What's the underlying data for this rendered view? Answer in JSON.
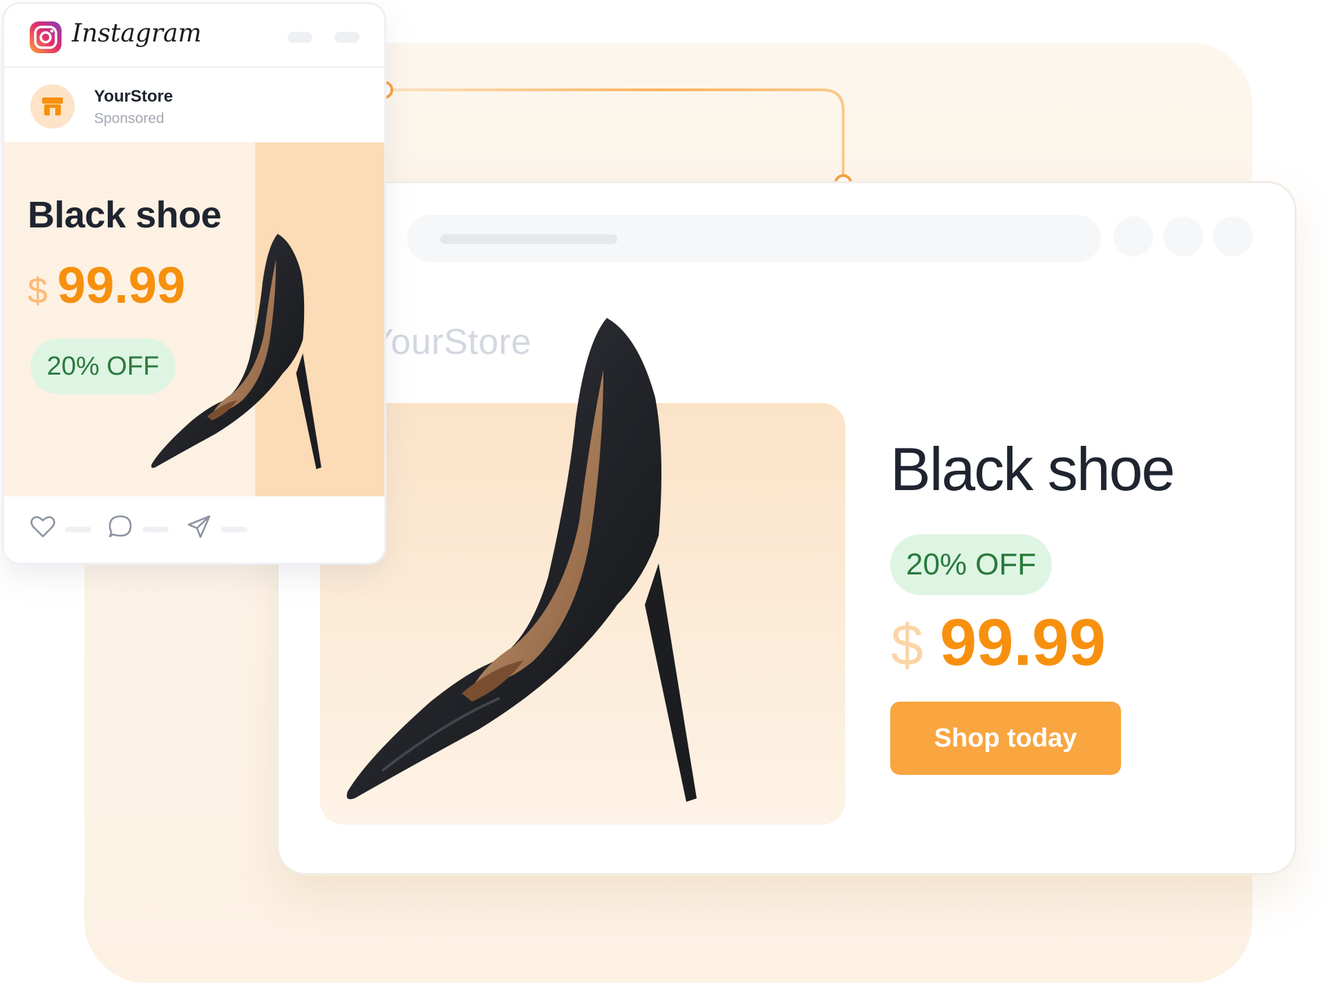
{
  "colors": {
    "accent": "#f7900e",
    "button": "#f9a540",
    "badge_bg": "#def5e3",
    "badge_text": "#2a7a3d",
    "dark_text": "#1f2430"
  },
  "instagram_ad": {
    "app_name": "Instagram",
    "account": {
      "name": "YourStore",
      "label": "Sponsored",
      "avatar_icon": "store-icon"
    },
    "post": {
      "title": "Black shoe",
      "currency": "$",
      "price": "99.99",
      "discount": "20% OFF",
      "image": "black-stiletto-shoe"
    },
    "actions": [
      "heart-icon",
      "comment-icon",
      "send-icon"
    ]
  },
  "browser": {
    "store_name": "YourStore",
    "product": {
      "title": "Black shoe",
      "discount": "20% OFF",
      "currency": "$",
      "price": "99.99",
      "cta": "Shop today",
      "image": "black-stiletto-shoe"
    }
  }
}
